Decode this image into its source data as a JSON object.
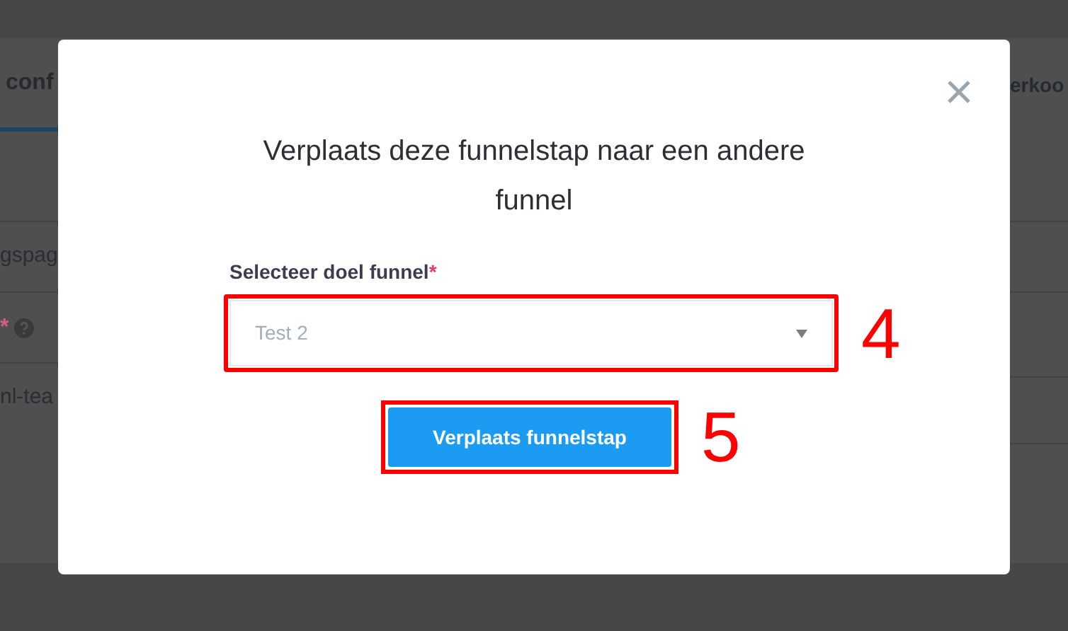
{
  "background": {
    "left_tab": "conf",
    "right_tab": "erkoo",
    "left_rows": [
      {
        "kind": "text",
        "text": "gspag"
      },
      {
        "kind": "required",
        "text": "*"
      },
      {
        "kind": "text",
        "text": "nl-tea"
      }
    ]
  },
  "dialog": {
    "title": "Verplaats deze funnelstap naar een andere funnel",
    "field": {
      "label": "Selecteer doel funnel",
      "required_mark": "*",
      "value": "Test 2",
      "annotation": "4"
    },
    "button": {
      "label": "Verplaats funnelstap",
      "annotation": "5"
    }
  }
}
